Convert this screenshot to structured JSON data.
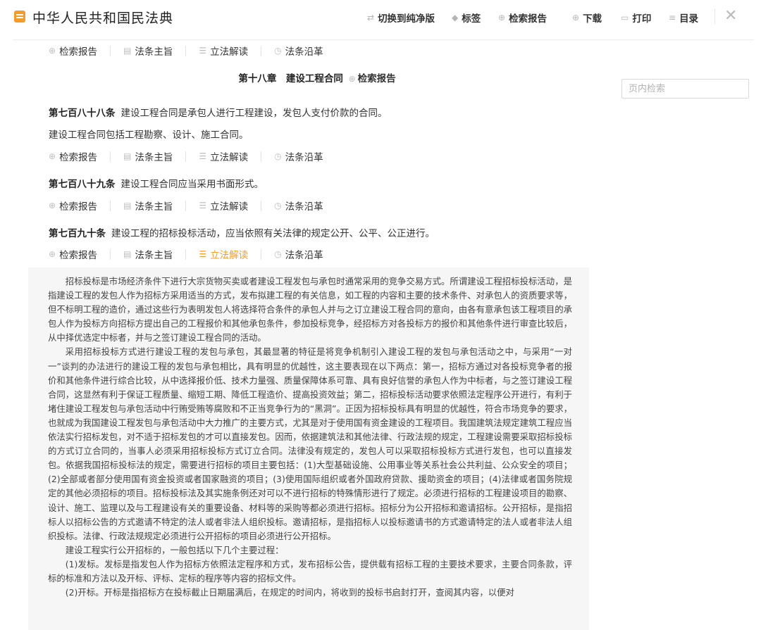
{
  "app": {
    "title": "中华人民共和国民法典"
  },
  "toolbar": {
    "switch_label": "切换到纯净版",
    "tags_label": "标签",
    "report_label": "检索报告",
    "download_label": "下载",
    "print_label": "打印",
    "toc_label": "目录"
  },
  "links": {
    "report": "检索报告",
    "purpose": "法条主旨",
    "interpretation": "立法解读",
    "history": "法条沿革"
  },
  "chapter": {
    "title": "第十八章　建设工程合同",
    "report": "检索报告"
  },
  "search": {
    "placeholder": "页内检索"
  },
  "articles": [
    {
      "number": "第七百八十八条",
      "text": "建设工程合同是承包人进行工程建设，发包人支付价款的合同。",
      "text2": "建设工程合同包括工程勘察、设计、施工合同。"
    },
    {
      "number": "第七百八十九条",
      "text": "建设工程合同应当采用书面形式。"
    },
    {
      "number": "第七百九十条",
      "text": "建设工程的招标投标活动，应当依照有关法律的规定公开、公平、公正进行。"
    }
  ],
  "interpretation": {
    "paragraphs": [
      "招标投标是市场经济条件下进行大宗货物买卖或者建设工程发包与承包时通常采用的竞争交易方式。所谓建设工程招标投标活动，是指建设工程的发包人作为招标方采用适当的方式，发布拟建工程的有关信息，如工程的内容和主要的技术条件、对承包人的资质要求等，但不标明工程的造价，通过这些行为表明发包人将选择符合条件的承包人并与之订立建设工程合同的意向，由各有意承包该工程项目的承包人作为投标方向招标方提出自己的工程报价和其他承包条件，参加投标竞争，经招标方对各投标方的报价和其他条件进行审查比较后，从中择优选定中标者，并与之签订建设工程合同的活动。",
      "采用招标投标方式进行建设工程的发包与承包，其最显著的特征是将竞争机制引入建设工程的发包与承包活动之中，与采用“一对一”谈判的办法进行的建设工程的发包与承包相比，具有明显的优越性，这主要表现在以下两点：第一，招标方通过对各投标竞争者的报价和其他条件进行综合比较，从中选择报价低、技术力量强、质量保障体系可靠、具有良好信誉的承包人作为中标者，与之签订建设工程合同，这显然有利于保证工程质量、缩短工期、降低工程造价、提高投资效益；第二，招标投标活动要求依照法定程序公开进行，有利于堵住建设工程发包与承包活动中行贿受贿等腐败和不正当竞争行为的“黑洞”。正因为招标投标具有明显的优越性，符合市场竞争的要求，也就成为我国建设工程发包与承包活动中大力推广的主要方式，尤其是对于使用国有资金建设的工程项目。我国建筑法规定建筑工程应当依法实行招标发包，对不适于招标发包的才可以直接发包。因而，依据建筑法和其他法律、行政法规的规定，工程建设需要采取招标投标的方式订立合同的，当事人必须采用招标投标方式订立合同。法律没有规定的，发包人可以采取招标投标方式进行发包，也可以直接发包。依据我国招标投标法的规定，需要进行招标的项目主要包括：(1)大型基础设施、公用事业等关系社会公共利益、公众安全的项目；(2)全部或者部分使用国有资金投资或者国家融资的项目；(3)使用国际组织或者外国政府贷款、援助资金的项目；(4)法律或者国务院规定的其他必须招标的项目。招标投标法及其实施条例还对可以不进行招标的特殊情形进行了规定。必须进行招标的工程建设项目的勘察、设计、施工、监理以及与工程建设有关的重要设备、材料等的采购等都必须进行招标。招标分为公开招标和邀请招标。公开招标，是指招标人以招标公告的方式邀请不特定的法人或者非法人组织投标。邀请招标，是指招标人以投标邀请书的方式邀请特定的法人或者非法人组织投标。法律、行政法规规定必须进行公开招标的项目必须进行公开招标。",
      "建设工程实行公开招标的，一般包括以下几个主要过程：",
      "(1)发标。发标是指发包人作为招标方依照法定程序和方式，发布招标公告，提供载有招标工程的主要技术要求，主要合同条款，评标的标准和方法以及开标、评标、定标的程序等内容的招标文件。",
      "(2)开标。开标是指招标方在投标截止日期届满后，在规定的时间内，将收到的投标书启封打开，查阅其内容，以便对"
    ]
  }
}
